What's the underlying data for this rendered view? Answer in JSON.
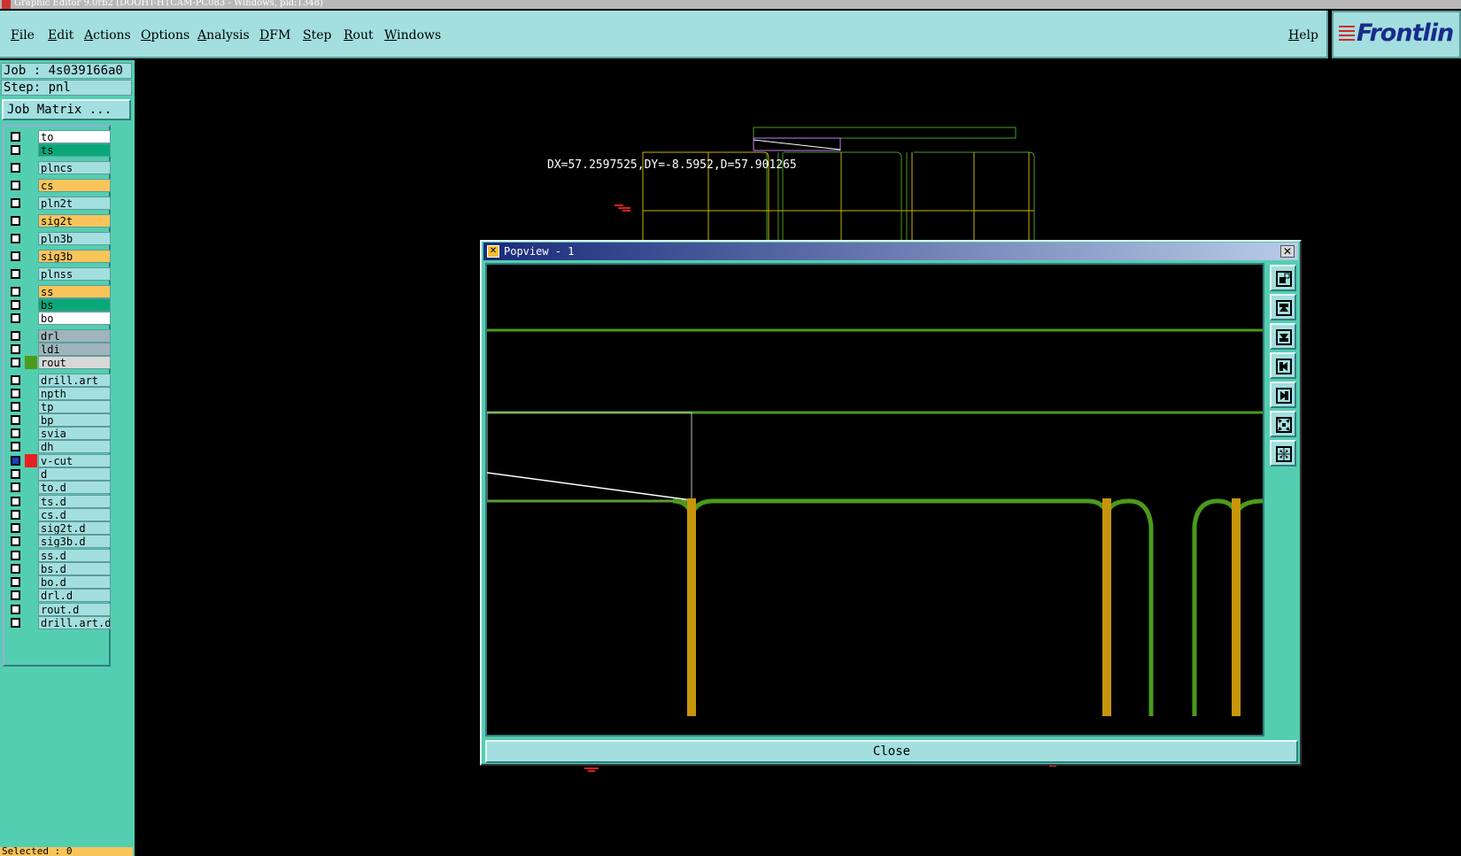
{
  "window": {
    "title": "Graphic Editor 9.0rb2 (DOOHT-HTCAM-PC083 - Windows, pid:1348)"
  },
  "menu": {
    "items": [
      "File",
      "Edit",
      "Actions",
      "Options",
      "Analysis",
      "DFM",
      "Step",
      "Rout",
      "Windows"
    ],
    "help": "Help"
  },
  "logo": {
    "text": "Frontlin"
  },
  "job": {
    "label": "Job : 4s039166a0",
    "step": "Step: pnl",
    "matrix_button": "Job Matrix ..."
  },
  "layers": [
    {
      "name": "to",
      "bg": "#ffffff",
      "indicator": "",
      "checked": false
    },
    {
      "name": "ts",
      "bg": "#0aa878",
      "indicator": "",
      "checked": false
    },
    {
      "name": "plncs",
      "bg": "#a3dfdf",
      "indicator": "",
      "checked": false
    },
    {
      "name": "cs",
      "bg": "#f9c55b",
      "indicator": "",
      "checked": false
    },
    {
      "name": "pln2t",
      "bg": "#a3dfdf",
      "indicator": "",
      "checked": false
    },
    {
      "name": "sig2t",
      "bg": "#f9c55b",
      "indicator": "",
      "checked": false
    },
    {
      "name": "pln3b",
      "bg": "#a3dfdf",
      "indicator": "",
      "checked": false
    },
    {
      "name": "sig3b",
      "bg": "#f9c55b",
      "indicator": "",
      "checked": false
    },
    {
      "name": "plnss",
      "bg": "#a3dfdf",
      "indicator": "",
      "checked": false
    },
    {
      "name": "ss",
      "bg": "#f9c55b",
      "indicator": "",
      "checked": false
    },
    {
      "name": "bs",
      "bg": "#0aa878",
      "indicator": "",
      "checked": false
    },
    {
      "name": "bo",
      "bg": "#ffffff",
      "indicator": "",
      "checked": false
    },
    {
      "name": "drl",
      "bg": "#9fb5bb",
      "indicator": "",
      "checked": false
    },
    {
      "name": "ldi",
      "bg": "#9fb5bb",
      "indicator": "",
      "checked": false
    },
    {
      "name": "rout",
      "bg": "#d8d8d8",
      "indicator": "#4c9a1c",
      "checked": false
    },
    {
      "name": "drill.art",
      "bg": "#a3dfdf",
      "indicator": "",
      "checked": false
    },
    {
      "name": "npth",
      "bg": "#a3dfdf",
      "indicator": "",
      "checked": false
    },
    {
      "name": "tp",
      "bg": "#a3dfdf",
      "indicator": "",
      "checked": false
    },
    {
      "name": "bp",
      "bg": "#a3dfdf",
      "indicator": "",
      "checked": false
    },
    {
      "name": "svia",
      "bg": "#a3dfdf",
      "indicator": "",
      "checked": false
    },
    {
      "name": "dh",
      "bg": "#a3dfdf",
      "indicator": "",
      "checked": false
    },
    {
      "name": "v-cut",
      "bg": "#a3dfdf",
      "indicator": "#e82020",
      "checked": true
    },
    {
      "name": "d",
      "bg": "#a3dfdf",
      "indicator": "",
      "checked": false
    },
    {
      "name": "to.d",
      "bg": "#a3dfdf",
      "indicator": "",
      "checked": false
    },
    {
      "name": "ts.d",
      "bg": "#a3dfdf",
      "indicator": "",
      "checked": false
    },
    {
      "name": "cs.d",
      "bg": "#a3dfdf",
      "indicator": "",
      "checked": false
    },
    {
      "name": "sig2t.d",
      "bg": "#a3dfdf",
      "indicator": "",
      "checked": false
    },
    {
      "name": "sig3b.d",
      "bg": "#a3dfdf",
      "indicator": "",
      "checked": false
    },
    {
      "name": "ss.d",
      "bg": "#a3dfdf",
      "indicator": "",
      "checked": false
    },
    {
      "name": "bs.d",
      "bg": "#a3dfdf",
      "indicator": "",
      "checked": false
    },
    {
      "name": "bo.d",
      "bg": "#a3dfdf",
      "indicator": "",
      "checked": false
    },
    {
      "name": "drl.d",
      "bg": "#a3dfdf",
      "indicator": "",
      "checked": false
    },
    {
      "name": "rout.d",
      "bg": "#a3dfdf",
      "indicator": "",
      "checked": false
    },
    {
      "name": "drill.art.d",
      "bg": "#a3dfdf",
      "indicator": "",
      "checked": false
    }
  ],
  "status": {
    "selected": "Selected : 0"
  },
  "measurement": "DX=57.2597525,DY=-8.5952,D=57.901265",
  "popview": {
    "title": "Popview - 1",
    "close_label": "Close",
    "close_glyph": "✕"
  },
  "colors": {
    "panel": "#54ceb0",
    "button": "#a3dfdf",
    "rout_green": "#4c9a1c",
    "drill_gold": "#c8960c"
  }
}
